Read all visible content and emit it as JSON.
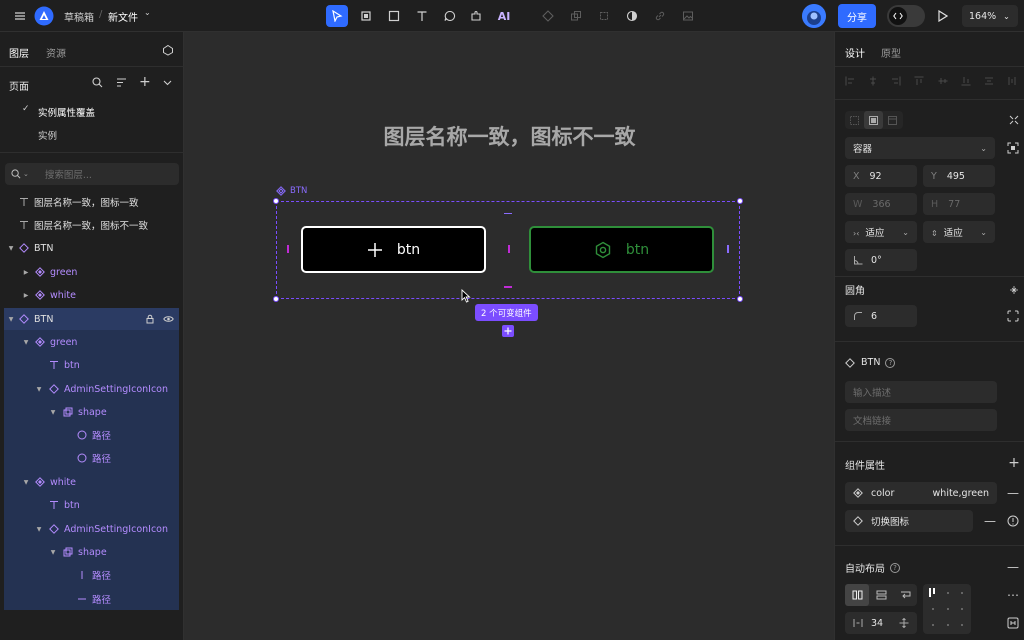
{
  "topbar": {
    "drafts": "草稿箱",
    "separator": "/",
    "file_name": "新文件",
    "ai_label": "AI",
    "share": "分享",
    "zoom": "164%"
  },
  "left": {
    "tabs": [
      "图层",
      "资源"
    ],
    "pages_label": "页面",
    "pages": [
      "实例属性覆盖",
      "实例"
    ],
    "search_placeholder": "搜索图层...",
    "layers": [
      {
        "label": "图层名称一致，图标一致",
        "icon": "text"
      },
      {
        "label": "图层名称一致，图标不一致",
        "icon": "text"
      },
      {
        "label": "BTN",
        "icon": "component"
      },
      {
        "label": "green",
        "icon": "variant"
      },
      {
        "label": "white",
        "icon": "variant"
      },
      {
        "label": "BTN",
        "icon": "component"
      },
      {
        "label": "green",
        "icon": "variant"
      },
      {
        "label": "btn",
        "icon": "text"
      },
      {
        "label": "AdminSettingIconIcon",
        "icon": "instance"
      },
      {
        "label": "shape",
        "icon": "group"
      },
      {
        "label": "路径",
        "icon": "ellipse"
      },
      {
        "label": "路径",
        "icon": "ellipse"
      },
      {
        "label": "white",
        "icon": "variant"
      },
      {
        "label": "btn",
        "icon": "text"
      },
      {
        "label": "AdminSettingIconIcon",
        "icon": "instance"
      },
      {
        "label": "shape",
        "icon": "group"
      },
      {
        "label": "路径",
        "icon": "vline"
      },
      {
        "label": "路径",
        "icon": "hline"
      }
    ]
  },
  "canvas": {
    "title": "图层名称一致，图标不一致",
    "frame_label": "BTN",
    "btn_white_label": "btn",
    "btn_green_label": "btn",
    "badge": "2 个可变组件"
  },
  "right": {
    "tabs": [
      "设计",
      "原型"
    ],
    "container": "容器",
    "x_label": "X",
    "x": "92",
    "y_label": "Y",
    "y": "495",
    "w_label": "W",
    "w": "366",
    "h_label": "H",
    "h": "77",
    "fit_h": "适应",
    "fit_v": "适应",
    "rotation": "0°",
    "radius_title": "圆角",
    "radius": "6",
    "component_name": "BTN",
    "desc_placeholder": "输入描述",
    "doc_placeholder": "文档链接",
    "props_title": "组件属性",
    "prop_color_name": "color",
    "prop_color_value": "white,green",
    "prop_icon_name": "切换图标",
    "autolayout_title": "自动布局",
    "gap": "34"
  },
  "colors": {
    "accent": "#2f6bff",
    "purple": "#7b4dff",
    "green_border": "#2f8f3a",
    "panel": "#1f1f1f",
    "canvas": "#2c2c2c"
  }
}
